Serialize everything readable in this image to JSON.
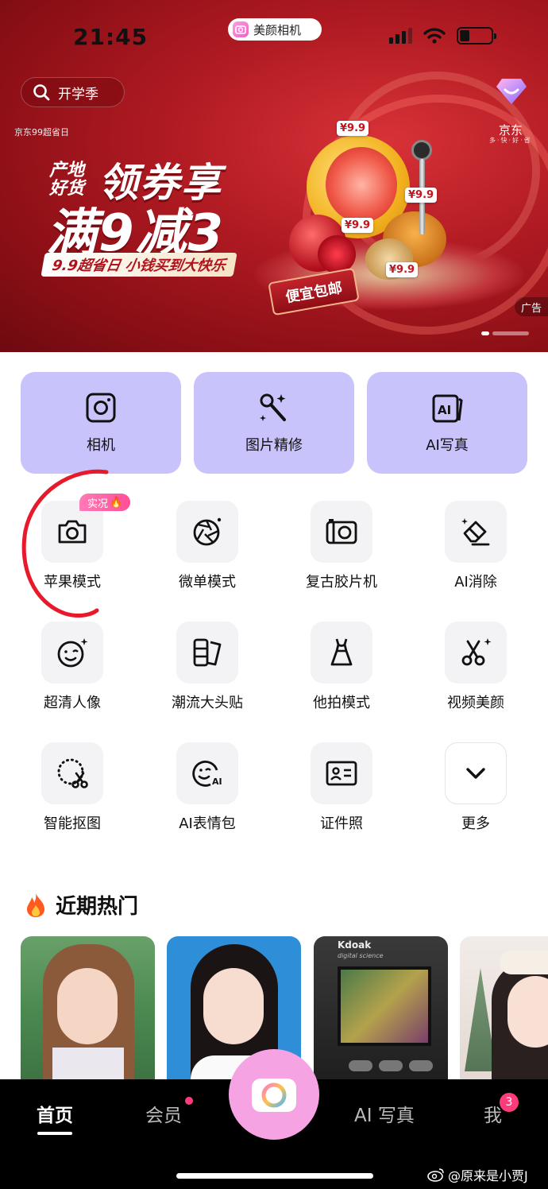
{
  "status_bar": {
    "time": "21:45",
    "app_pill": "美颜相机"
  },
  "banner": {
    "search_text": "开学季",
    "jd99_label": "京东99超省日",
    "jd_logo": "京东",
    "jd_slogan": "多·快·好·省",
    "headline_small": "产地好货",
    "headline_big": "领券享",
    "headline_line2": "满9减3",
    "strip": "9.9超省日 小钱买到大快乐",
    "package_label": "便宜包邮",
    "price_tag": "¥9.9",
    "ad_label": "广告"
  },
  "quick_tiles": [
    {
      "label": "相机",
      "icon": "camera-square-icon"
    },
    {
      "label": "图片精修",
      "icon": "makeup-brush-icon"
    },
    {
      "label": "AI写真",
      "icon": "ai-photo-icon"
    }
  ],
  "tools": [
    {
      "label": "苹果模式",
      "icon": "camera-icon"
    },
    {
      "label": "微单模式",
      "icon": "aperture-icon"
    },
    {
      "label": "复古胶片机",
      "icon": "film-camera-icon"
    },
    {
      "label": "AI消除",
      "icon": "eraser-icon"
    },
    {
      "label": "超清人像",
      "icon": "face-icon"
    },
    {
      "label": "潮流大头贴",
      "icon": "photo-sticker-icon"
    },
    {
      "label": "他拍模式",
      "icon": "dress-icon"
    },
    {
      "label": "视频美颜",
      "icon": "scissors-icon"
    },
    {
      "label": "智能抠图",
      "icon": "cutout-icon"
    },
    {
      "label": "AI表情包",
      "icon": "ai-emoji-icon"
    },
    {
      "label": "证件照",
      "icon": "id-card-icon"
    },
    {
      "label": "更多",
      "icon": "chevron-down-icon"
    }
  ],
  "live_badge": "实况",
  "section": {
    "title": "近期热门",
    "icon": "fire-icon"
  },
  "card_text": {
    "brand": "Kdoak",
    "sub": "digital science"
  },
  "tabbar": {
    "items": [
      {
        "label": "首页",
        "active": true
      },
      {
        "label": "会员",
        "active": false
      },
      {
        "label": "AI 写真",
        "active": false
      },
      {
        "label": "我",
        "active": false
      }
    ],
    "me_badge": "3"
  },
  "watermark": "@原来是小贾J",
  "colors": {
    "tile_purple": "#c9c3fb",
    "banner_red": "#b01a22",
    "accent_pink": "#ff3c7a",
    "camera_button": "#f6a3e4"
  }
}
